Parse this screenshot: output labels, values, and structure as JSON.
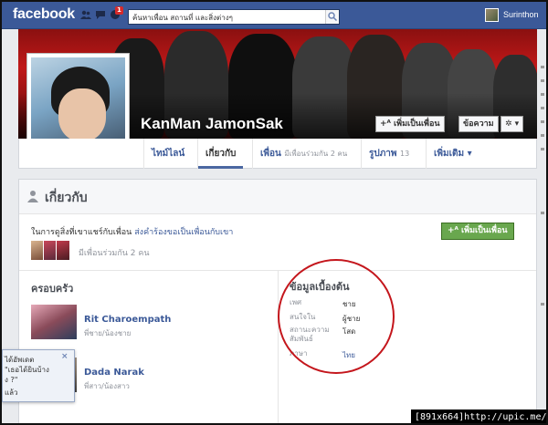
{
  "topbar": {
    "logo": "facebook",
    "notification_count": "1",
    "search_placeholder": "ค้นหาเพื่อน สถานที่ และสิ่งต่างๆ",
    "user_name": "Surinthon"
  },
  "profile": {
    "name": "KanMan JamonSak",
    "add_friend_label": "+ᴬ เพิ่มเป็นเพื่อน",
    "message_label": "ข้อความ",
    "gear_label": "✲ ▾"
  },
  "tabs": [
    {
      "label": "ไทม์ไลน์",
      "sub": ""
    },
    {
      "label": "เกี่ยวกับ",
      "sub": ""
    },
    {
      "label": "เพื่อน",
      "sub": "มีเพื่อนร่วมกัน 2 คน"
    },
    {
      "label": "รูปภาพ",
      "sub": "13"
    },
    {
      "label": "เพิ่มเติม ▾",
      "sub": ""
    }
  ],
  "about": {
    "title": "เกี่ยวกับ",
    "share_text": "ในการดูสิ่งที่เขาแชร์กับเพื่อน",
    "share_link": "ส่งคำร้องขอเป็นเพื่อนกับเขา",
    "add_friend_button": "+ᴬ เพิ่มเป็นเพื่อน",
    "mutual_text": "มีเพื่อนร่วมกัน 2 คน",
    "family_title": "ครอบครัว",
    "family": [
      {
        "name": "Rit Charoempath",
        "relation": "พี่ชาย/น้องชาย"
      },
      {
        "name": "Dada Narak",
        "relation": "พี่สาว/น้องสาว"
      }
    ],
    "basic_title": "ข้อมูลเบื้องต้น",
    "basic": [
      {
        "label": "เพศ",
        "value": "ชาย"
      },
      {
        "label": "สนใจใน",
        "value": "ผู้ชาย"
      },
      {
        "label": "สถานะความสัมพันธ์",
        "value": "โสด"
      },
      {
        "label": "ภาษา",
        "value": "ไทย"
      }
    ]
  },
  "popup": {
    "line1": "ได้อัพเดต",
    "line2": "\"เธอได้ยินบ้าง",
    "line3": "ง ?\"",
    "line4": "แล้ว",
    "close": "×"
  },
  "watermark": "[891x664]http://upic.me/",
  "colors": {
    "brand": "#3b5998",
    "green_button": "#69a74e",
    "highlight_circle": "#c4161c"
  }
}
